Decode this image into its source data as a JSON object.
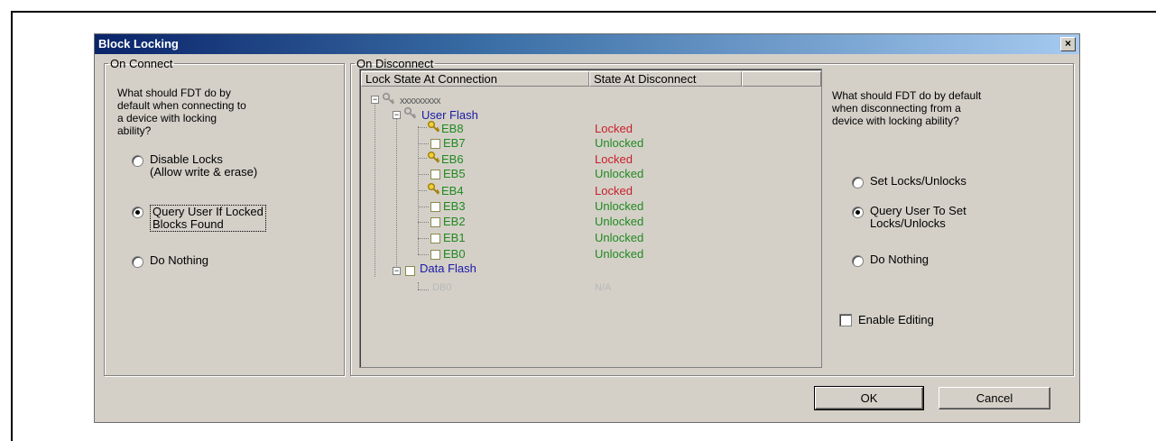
{
  "dialog": {
    "title": "Block Locking",
    "close_glyph": "×"
  },
  "on_connect": {
    "legend": "On Connect",
    "question": "What should FDT do by\ndefault when connecting to\na device with locking\nability?",
    "options": [
      {
        "label": "Disable Locks\n(Allow write & erase)",
        "selected": false
      },
      {
        "label": "Query User If Locked\nBlocks Found",
        "selected": true
      },
      {
        "label": "Do Nothing",
        "selected": false
      }
    ]
  },
  "on_disconnect": {
    "legend": "On Disconnect",
    "columns": [
      "Lock State At Connection",
      "State At Disconnect"
    ],
    "tree": {
      "root": "xxxxxxxxx",
      "user_flash": {
        "label": "User Flash",
        "blocks": [
          {
            "name": "EB8",
            "state": "Locked"
          },
          {
            "name": "EB7",
            "state": "Unlocked"
          },
          {
            "name": "EB6",
            "state": "Locked"
          },
          {
            "name": "EB5",
            "state": "Unlocked"
          },
          {
            "name": "EB4",
            "state": "Locked"
          },
          {
            "name": "EB3",
            "state": "Unlocked"
          },
          {
            "name": "EB2",
            "state": "Unlocked"
          },
          {
            "name": "EB1",
            "state": "Unlocked"
          },
          {
            "name": "EB0",
            "state": "Unlocked"
          }
        ]
      },
      "data_flash": {
        "label": "Data Flash",
        "blocks": [
          {
            "name": "DB0",
            "state": "N/A"
          }
        ]
      }
    },
    "question": "What should FDT do by default\nwhen disconnecting from a\ndevice with locking ability?",
    "options": [
      {
        "label": "Set Locks/Unlocks",
        "selected": false
      },
      {
        "label": "Query User To Set\nLocks/Unlocks",
        "selected": true
      },
      {
        "label": "Do Nothing",
        "selected": false
      }
    ],
    "enable_editing": {
      "label": "Enable Editing",
      "checked": false
    }
  },
  "buttons": {
    "ok": "OK",
    "cancel": "Cancel"
  },
  "colors": {
    "locked": "#c8202a",
    "unlocked": "#208a20",
    "tree_folder": "#1a1aa6",
    "disabled": "#a0a0a0"
  }
}
